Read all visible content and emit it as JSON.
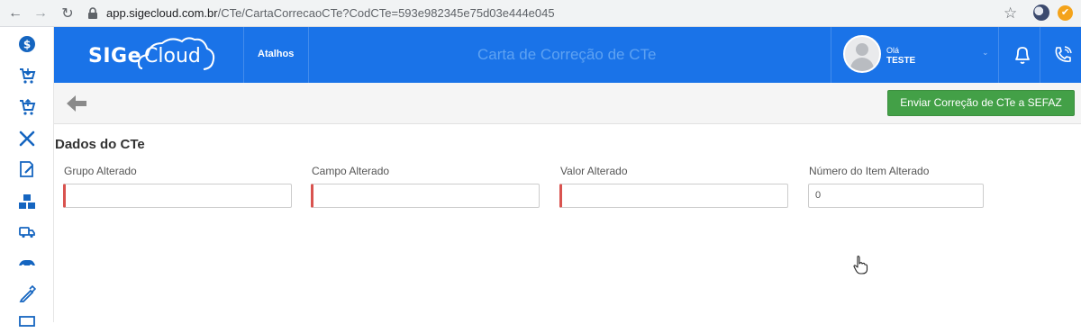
{
  "browser": {
    "url_host": "app.sigecloud.com.br",
    "url_path": "/CTe/CartaCorrecaoCTe?CodCTe=593e982345e75d03e444e045",
    "ext2_glyph": "✔"
  },
  "sidebar": {
    "items": [
      {
        "icon": "dollar-icon"
      },
      {
        "icon": "cart-icon"
      },
      {
        "icon": "cart-icon"
      },
      {
        "icon": "tools-icon"
      },
      {
        "icon": "edit-document-icon"
      },
      {
        "icon": "boxes-icon"
      },
      {
        "icon": "truck-icon"
      },
      {
        "icon": "car-icon"
      },
      {
        "icon": "pencil-icon"
      },
      {
        "icon": "monitor-icon"
      }
    ]
  },
  "header": {
    "logo_sige": "SIGe",
    "logo_cloud": "Cloud",
    "shortcuts_label": "Atalhos",
    "page_title": "Carta de Correção de CTe",
    "greeting": "Olá",
    "user_name": "TESTE",
    "caret": "⌵"
  },
  "toolbar": {
    "send_button_label": "Enviar Correção de CTe a SEFAZ"
  },
  "form": {
    "section_title": "Dados do CTe",
    "fields": [
      {
        "label": "Grupo Alterado",
        "value": "",
        "required": true
      },
      {
        "label": "Campo Alterado",
        "value": "",
        "required": true
      },
      {
        "label": "Valor Alterado",
        "value": "",
        "required": true
      },
      {
        "label": "Número do Item Alterado",
        "value": "0",
        "required": false
      }
    ]
  },
  "colors": {
    "header": "#1a73e8",
    "sidebar_icon": "#1565c0",
    "send_button": "#43a047",
    "required_marker": "#d9534f"
  }
}
